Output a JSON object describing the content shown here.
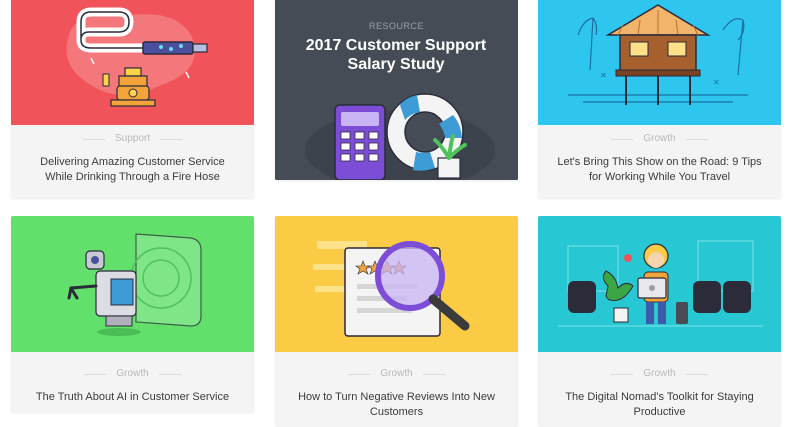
{
  "cards": [
    {
      "category": "Support",
      "title": "Delivering Amazing Customer Service While Drinking Through a Fire Hose",
      "illustration": "fire-hydrant-hose-icon",
      "bg": "#f0545a"
    },
    {
      "label": "RESOURCE",
      "title": "2017 Customer Support Salary Study",
      "illustration": "calculator-lifebuoy-plant-icon",
      "bg": "#454c56"
    },
    {
      "category": "Growth",
      "title": "Let's Bring This Show on the Road: 9 Tips for Working While You Travel",
      "illustration": "beach-hut-palms-icon",
      "bg": "#2ec6ef"
    },
    {
      "category": "Growth",
      "title": "The Truth About AI in Customer Service",
      "illustration": "robot-icon",
      "bg": "#63e06b"
    },
    {
      "category": "Growth",
      "title": "How to Turn Negative Reviews Into New Customers",
      "illustration": "magnifier-review-icon",
      "bg": "#fbcb45"
    },
    {
      "category": "Growth",
      "title": "The Digital Nomad's Toolkit for Staying Productive",
      "illustration": "nomad-laptop-icon",
      "bg": "#27c7d3"
    }
  ]
}
